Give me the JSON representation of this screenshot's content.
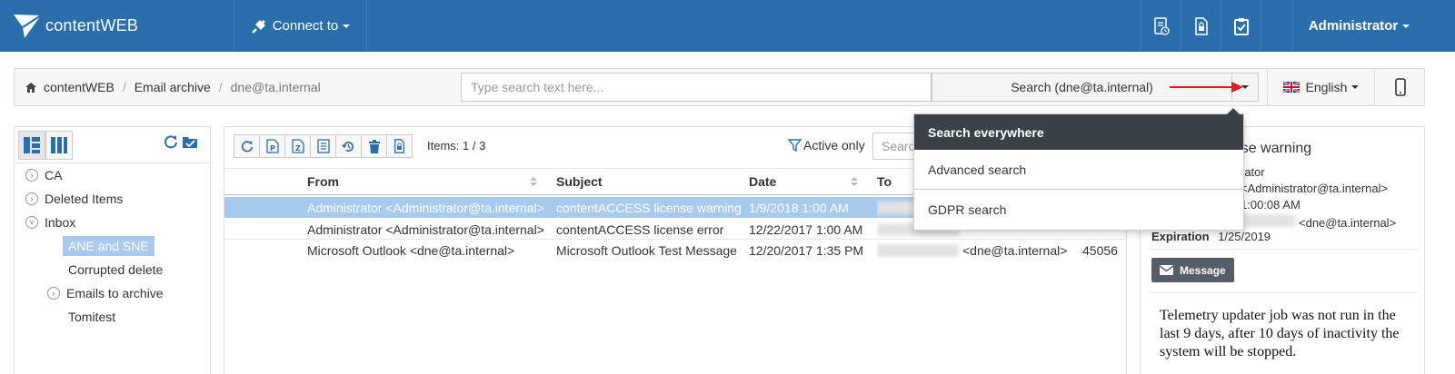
{
  "app": {
    "brand": "contentWEB",
    "connect_label": "Connect to",
    "user_label": "Administrator"
  },
  "breadcrumb": {
    "root": "contentWEB",
    "level1": "Email archive",
    "current": "dne@ta.internal"
  },
  "search": {
    "placeholder": "Type search text here...",
    "button_label": "Search (dne@ta.internal)"
  },
  "language": {
    "label": "English"
  },
  "search_menu": {
    "header": "Search everywhere",
    "items": [
      "Advanced search",
      "GDPR search"
    ]
  },
  "folders": {
    "items": [
      {
        "label": "CA"
      },
      {
        "label": "Deleted Items"
      },
      {
        "label": "Inbox"
      },
      {
        "label": "ANE and SNE"
      },
      {
        "label": "Corrupted delete"
      },
      {
        "label": "Emails to archive"
      },
      {
        "label": "Tomitest"
      }
    ]
  },
  "list": {
    "items_count": "Items: 1 / 3",
    "active_only_label": "Active only",
    "search_placeholder": "Search",
    "columns": {
      "from": "From",
      "subject": "Subject",
      "date": "Date",
      "to": "To"
    },
    "rows": [
      {
        "from": "Administrator <Administrator@ta.internal>",
        "subject": "contentACCESS license warning",
        "date": "1/9/2018 1:00 AM",
        "to": "",
        "size": ""
      },
      {
        "from": "Administrator <Administrator@ta.internal>",
        "subject": "contentACCESS license error",
        "date": "12/22/2017 1:00 AM",
        "to": "",
        "size": ""
      },
      {
        "from": "Microsoft Outlook <dne@ta.internal>",
        "subject": "Microsoft Outlook Test Message",
        "date": "12/20/2017 1:35 PM",
        "to": "<dne@ta.internal>",
        "size": "45056"
      }
    ]
  },
  "preview": {
    "title": "ense warning",
    "from_line": "rator",
    "from_addr": "<Administrator@ta.internal>",
    "date_line": "1:00:08 AM",
    "to_line": "<dne@ta.internal>",
    "expiration_label": "Expiration",
    "expiration_value": "1/25/2019",
    "message_button": "Message",
    "body": "Telemetry updater job was not run in the last 9 days, after 10 days of inactivity the system will be stopped."
  }
}
